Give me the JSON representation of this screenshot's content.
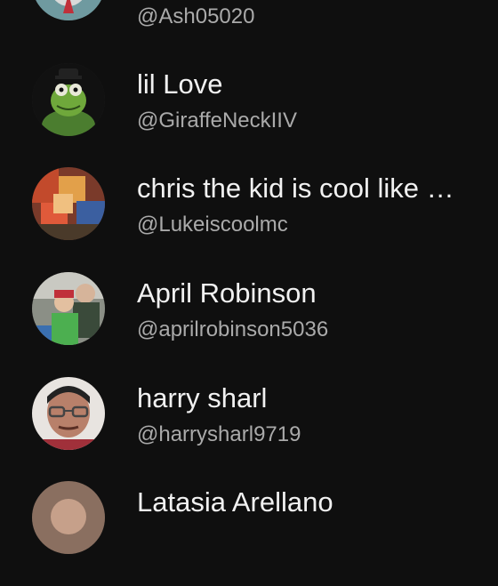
{
  "subscribers": [
    {
      "name": "",
      "handle": "@Ash05020",
      "avatar_icon": "anime-character-avatar"
    },
    {
      "name": "lil Love",
      "handle": "@GiraffeNeckIIV",
      "avatar_icon": "green-frog-avatar"
    },
    {
      "name": "chris the kid is cool like …",
      "handle": "@Lukeiscoolmc",
      "avatar_icon": "blocky-game-avatar"
    },
    {
      "name": "April Robinson",
      "handle": "@aprilrobinson5036",
      "avatar_icon": "family-photo-avatar"
    },
    {
      "name": "harry sharl",
      "handle": "@harrysharl9719",
      "avatar_icon": "man-with-glasses-avatar"
    },
    {
      "name": "Latasia Arellano",
      "handle": "",
      "avatar_icon": "person-avatar"
    }
  ]
}
